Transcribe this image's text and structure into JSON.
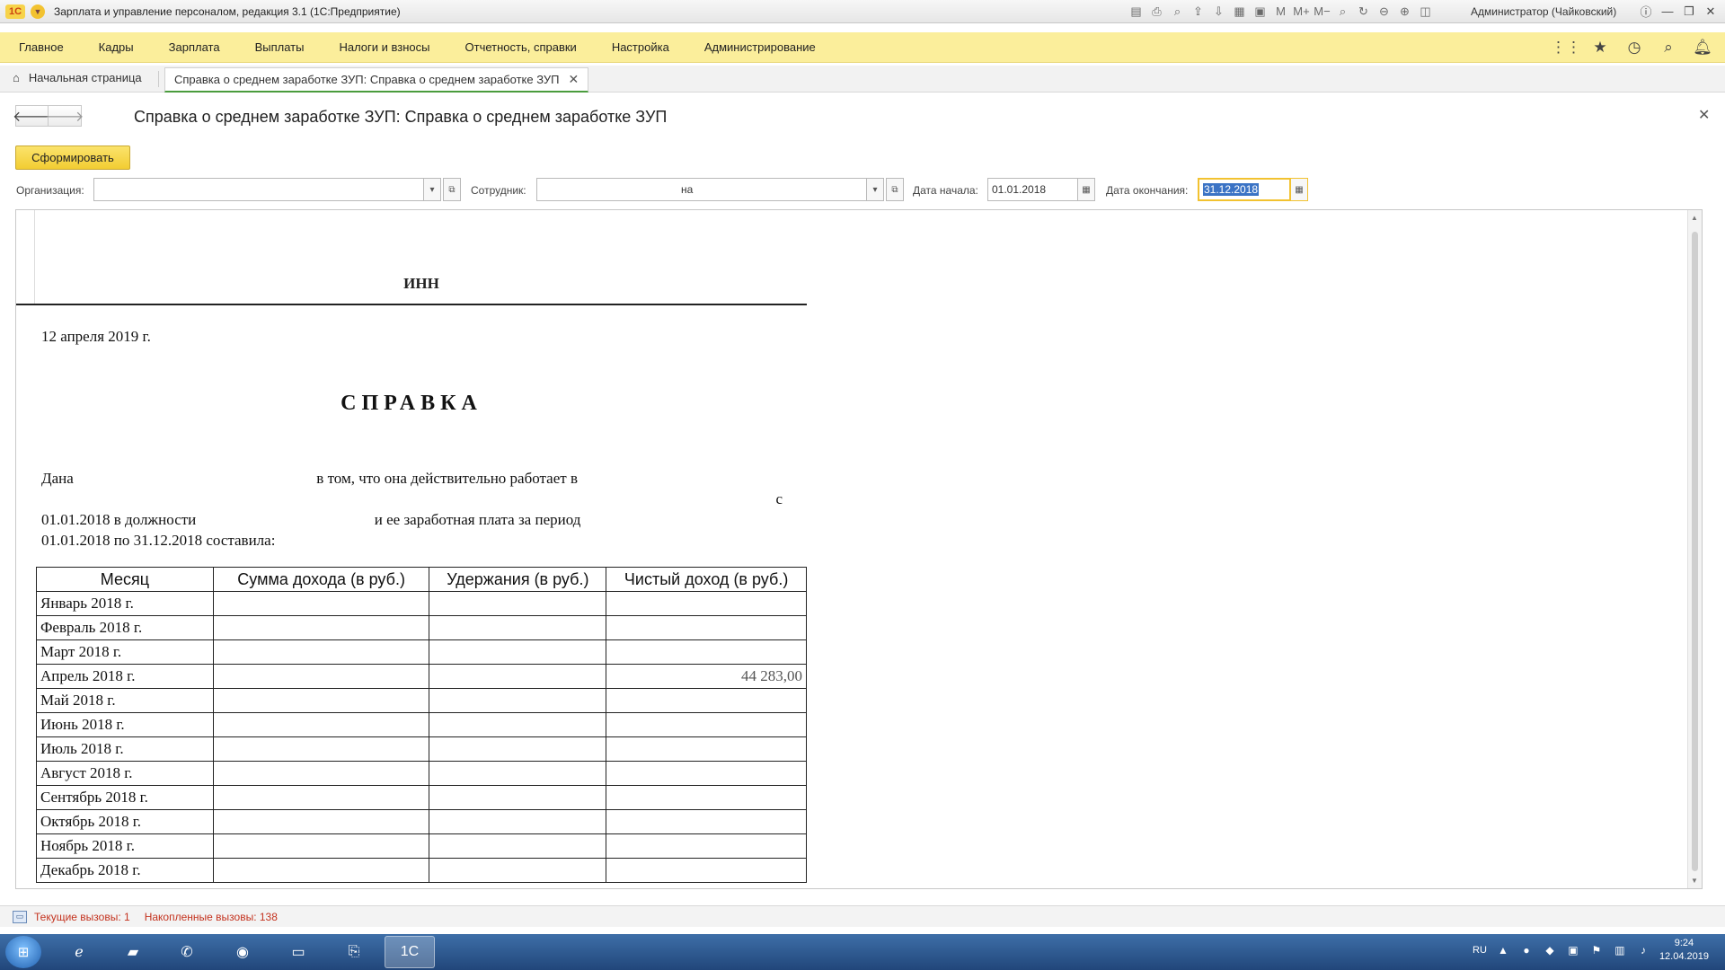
{
  "window": {
    "title": "Зарплата и управление персоналом, редакция 3.1  (1С:Предприятие)",
    "user": "Администратор (Чайковский)",
    "logo": "1С"
  },
  "menu": {
    "items": [
      "Главное",
      "Кадры",
      "Зарплата",
      "Выплаты",
      "Налоги и взносы",
      "Отчетность, справки",
      "Настройка",
      "Администрирование"
    ]
  },
  "tabs": {
    "home": "Начальная страница",
    "active": "Справка о среднем заработке ЗУП: Справка о среднем заработке ЗУП"
  },
  "form": {
    "title": "Справка о среднем заработке ЗУП: Справка о среднем заработке ЗУП",
    "generate_button": "Сформировать",
    "org_label": "Организация:",
    "org_value": "",
    "employee_label": "Сотрудник:",
    "employee_value": "на",
    "start_label": "Дата начала:",
    "start_value": "01.01.2018",
    "end_label": "Дата окончания:",
    "end_value": "31.12.2018"
  },
  "document": {
    "header_lines": [
      "ИНН"
    ],
    "date": "12 апреля 2019 г.",
    "title": "СПРАВКА",
    "body_line1": "Дана",
    "body_line1b": "в  том,  что  она  действительно  работает  в",
    "body_line2": "с",
    "body_line3a": "01.01.2018  в  должности",
    "body_line3b": "и  ее  заработная  плата  за  период",
    "body_line4": "01.01.2018 по 31.12.2018 составила:",
    "table": {
      "headers": [
        "Месяц",
        "Сумма дохода (в руб.)",
        "Удержания (в руб.)",
        "Чистый доход (в руб.)"
      ],
      "rows": [
        [
          "Январь 2018 г.",
          "",
          "",
          ""
        ],
        [
          "Февраль 2018 г.",
          "",
          "",
          ""
        ],
        [
          "Март 2018 г.",
          "",
          "",
          ""
        ],
        [
          "Апрель 2018 г.",
          "",
          "",
          "44 283,00"
        ],
        [
          "Май 2018 г.",
          "",
          "",
          ""
        ],
        [
          "Июнь 2018 г.",
          "",
          "",
          ""
        ],
        [
          "Июль 2018 г.",
          "",
          "",
          ""
        ],
        [
          "Август 2018 г.",
          "",
          "",
          ""
        ],
        [
          "Сентябрь 2018 г.",
          "",
          "",
          ""
        ],
        [
          "Октябрь 2018 г.",
          "",
          "",
          ""
        ],
        [
          "Ноябрь 2018 г.",
          "",
          "",
          ""
        ],
        [
          "Декабрь 2018 г.",
          "",
          "",
          ""
        ]
      ]
    }
  },
  "status": {
    "current_calls": "Текущие вызовы: 1",
    "accumulated_calls": "Накопленные вызовы: 138"
  },
  "taskbar": {
    "language": "RU",
    "time": "9:24",
    "date": "12.04.2019"
  }
}
